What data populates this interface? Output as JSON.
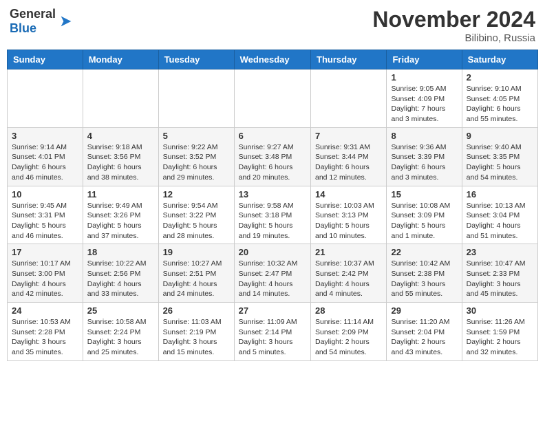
{
  "header": {
    "logo_general": "General",
    "logo_blue": "Blue",
    "month_title": "November 2024",
    "location": "Bilibino, Russia"
  },
  "weekdays": [
    "Sunday",
    "Monday",
    "Tuesday",
    "Wednesday",
    "Thursday",
    "Friday",
    "Saturday"
  ],
  "weeks": [
    [
      {
        "day": "",
        "info": ""
      },
      {
        "day": "",
        "info": ""
      },
      {
        "day": "",
        "info": ""
      },
      {
        "day": "",
        "info": ""
      },
      {
        "day": "",
        "info": ""
      },
      {
        "day": "1",
        "info": "Sunrise: 9:05 AM\nSunset: 4:09 PM\nDaylight: 7 hours and 3 minutes."
      },
      {
        "day": "2",
        "info": "Sunrise: 9:10 AM\nSunset: 4:05 PM\nDaylight: 6 hours and 55 minutes."
      }
    ],
    [
      {
        "day": "3",
        "info": "Sunrise: 9:14 AM\nSunset: 4:01 PM\nDaylight: 6 hours and 46 minutes."
      },
      {
        "day": "4",
        "info": "Sunrise: 9:18 AM\nSunset: 3:56 PM\nDaylight: 6 hours and 38 minutes."
      },
      {
        "day": "5",
        "info": "Sunrise: 9:22 AM\nSunset: 3:52 PM\nDaylight: 6 hours and 29 minutes."
      },
      {
        "day": "6",
        "info": "Sunrise: 9:27 AM\nSunset: 3:48 PM\nDaylight: 6 hours and 20 minutes."
      },
      {
        "day": "7",
        "info": "Sunrise: 9:31 AM\nSunset: 3:44 PM\nDaylight: 6 hours and 12 minutes."
      },
      {
        "day": "8",
        "info": "Sunrise: 9:36 AM\nSunset: 3:39 PM\nDaylight: 6 hours and 3 minutes."
      },
      {
        "day": "9",
        "info": "Sunrise: 9:40 AM\nSunset: 3:35 PM\nDaylight: 5 hours and 54 minutes."
      }
    ],
    [
      {
        "day": "10",
        "info": "Sunrise: 9:45 AM\nSunset: 3:31 PM\nDaylight: 5 hours and 46 minutes."
      },
      {
        "day": "11",
        "info": "Sunrise: 9:49 AM\nSunset: 3:26 PM\nDaylight: 5 hours and 37 minutes."
      },
      {
        "day": "12",
        "info": "Sunrise: 9:54 AM\nSunset: 3:22 PM\nDaylight: 5 hours and 28 minutes."
      },
      {
        "day": "13",
        "info": "Sunrise: 9:58 AM\nSunset: 3:18 PM\nDaylight: 5 hours and 19 minutes."
      },
      {
        "day": "14",
        "info": "Sunrise: 10:03 AM\nSunset: 3:13 PM\nDaylight: 5 hours and 10 minutes."
      },
      {
        "day": "15",
        "info": "Sunrise: 10:08 AM\nSunset: 3:09 PM\nDaylight: 5 hours and 1 minute."
      },
      {
        "day": "16",
        "info": "Sunrise: 10:13 AM\nSunset: 3:04 PM\nDaylight: 4 hours and 51 minutes."
      }
    ],
    [
      {
        "day": "17",
        "info": "Sunrise: 10:17 AM\nSunset: 3:00 PM\nDaylight: 4 hours and 42 minutes."
      },
      {
        "day": "18",
        "info": "Sunrise: 10:22 AM\nSunset: 2:56 PM\nDaylight: 4 hours and 33 minutes."
      },
      {
        "day": "19",
        "info": "Sunrise: 10:27 AM\nSunset: 2:51 PM\nDaylight: 4 hours and 24 minutes."
      },
      {
        "day": "20",
        "info": "Sunrise: 10:32 AM\nSunset: 2:47 PM\nDaylight: 4 hours and 14 minutes."
      },
      {
        "day": "21",
        "info": "Sunrise: 10:37 AM\nSunset: 2:42 PM\nDaylight: 4 hours and 4 minutes."
      },
      {
        "day": "22",
        "info": "Sunrise: 10:42 AM\nSunset: 2:38 PM\nDaylight: 3 hours and 55 minutes."
      },
      {
        "day": "23",
        "info": "Sunrise: 10:47 AM\nSunset: 2:33 PM\nDaylight: 3 hours and 45 minutes."
      }
    ],
    [
      {
        "day": "24",
        "info": "Sunrise: 10:53 AM\nSunset: 2:28 PM\nDaylight: 3 hours and 35 minutes."
      },
      {
        "day": "25",
        "info": "Sunrise: 10:58 AM\nSunset: 2:24 PM\nDaylight: 3 hours and 25 minutes."
      },
      {
        "day": "26",
        "info": "Sunrise: 11:03 AM\nSunset: 2:19 PM\nDaylight: 3 hours and 15 minutes."
      },
      {
        "day": "27",
        "info": "Sunrise: 11:09 AM\nSunset: 2:14 PM\nDaylight: 3 hours and 5 minutes."
      },
      {
        "day": "28",
        "info": "Sunrise: 11:14 AM\nSunset: 2:09 PM\nDaylight: 2 hours and 54 minutes."
      },
      {
        "day": "29",
        "info": "Sunrise: 11:20 AM\nSunset: 2:04 PM\nDaylight: 2 hours and 43 minutes."
      },
      {
        "day": "30",
        "info": "Sunrise: 11:26 AM\nSunset: 1:59 PM\nDaylight: 2 hours and 32 minutes."
      }
    ]
  ]
}
